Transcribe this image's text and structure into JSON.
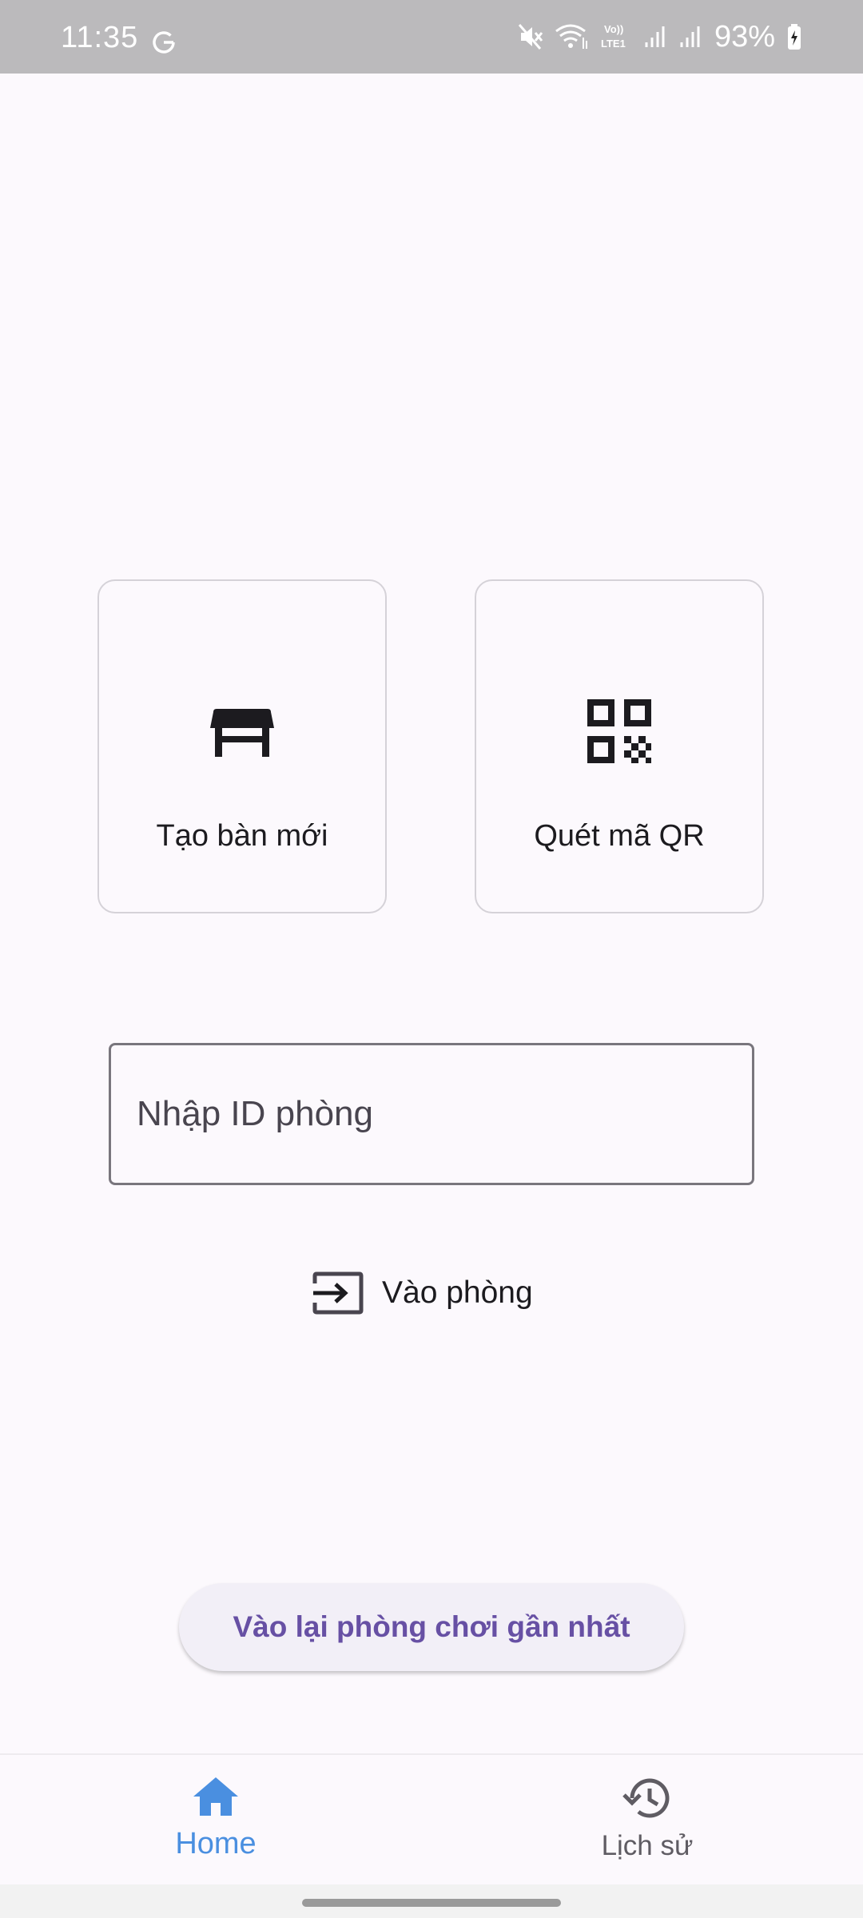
{
  "status_bar": {
    "time": "11:35",
    "battery": "93%",
    "icons": [
      "google-g-icon",
      "mute-icon",
      "wifi-icon",
      "volte-icon",
      "signal-icon",
      "signal-icon",
      "battery-charging-icon"
    ]
  },
  "cards": {
    "create_table": {
      "label": "Tạo bàn mới",
      "icon": "table-icon"
    },
    "scan_qr": {
      "label": "Quét mã QR",
      "icon": "qr-code-icon"
    }
  },
  "room_input": {
    "placeholder": "Nhập ID phòng",
    "value": ""
  },
  "join_button": {
    "label": "Vào phòng",
    "icon": "login-icon"
  },
  "rejoin_button": {
    "label": "Vào lại phòng chơi gần nhất"
  },
  "bottom_nav": {
    "items": [
      {
        "label": "Home",
        "icon": "home-icon",
        "active": true
      },
      {
        "label": "Lịch sử",
        "icon": "history-icon",
        "active": false
      }
    ]
  },
  "colors": {
    "background": "#fcf9fd",
    "primary": "#6750a4",
    "nav_active": "#4a8fe0",
    "status_bar": "#bbbabc"
  }
}
